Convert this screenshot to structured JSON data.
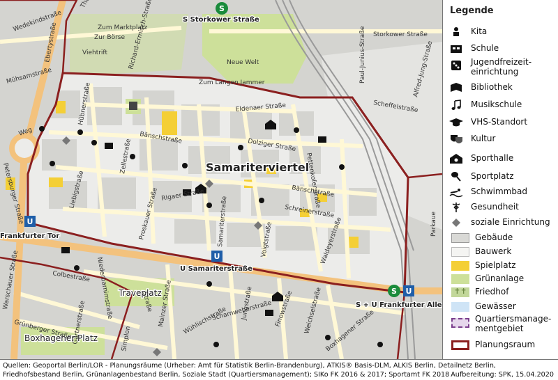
{
  "map": {
    "area_label": "Samariterviertel",
    "stations": {
      "storkower": "S Storkower Straße",
      "frankfurter_tor": "Frankfurter Tor",
      "samariterstrasse": "U Samariterstraße",
      "frankfurter_allee": "S + U Frankfurter Allee"
    },
    "places": {
      "traveplatz": "Traveplatz",
      "boxhagener_platz": "Boxhagener Platz"
    },
    "streets": {
      "storkower": "Storkower Straße",
      "zum_langen_jammer": "Zum Langen Jammer",
      "neue_welt": "Neue Welt",
      "viehtrift": "Viehtrift",
      "zur_boerse": "Zur Börse",
      "zum_marktplatz": "Zum Marktplatz",
      "thaerstrasse": "Thaerstraße",
      "richard_ermisch": "Richard-Ermisch-Straße",
      "paul_junius": "Paul-Junius-Straße",
      "alfred_jung": "Alfred-Jung-Straße",
      "scheffelstrasse": "Scheffelstraße",
      "mühsamstrasse": "Mühsamstraße",
      "ebertystrasse": "Ebertystraße",
      "wedekindstrasse": "Wedekindstraße",
      "huebnerstrasse": "Hübnerstraße",
      "eldenaer": "Eldenaer Straße",
      "dolziger": "Dolziger Straße",
      "baenschstrasse": "Bänschstraße",
      "baenschstrasse2": "Bänschstraße",
      "schreinerstrasse": "Schreinerstraße",
      "liebigstrasse": "Liebigstraße",
      "rigaer": "Rigaer Straße",
      "proskauer": "Proskauer Straße",
      "samariterstrasse": "Samariterstraße",
      "voigtstrasse": "Voigtstraße",
      "waldeyerstrasse": "Waldeyerstraße",
      "pettenkofer": "Pettenkoferstraße",
      "zellestrasse": "Zellestraße",
      "petersburger": "Petersburger Straße",
      "niederbarnim": "Niederbarnimstraße",
      "colbestrasse": "Colbestraße",
      "mainzer": "Mainzer Straße",
      "jungstrasse": "Jungstraße",
      "finowstrasse": "Finowstraße",
      "weichselstrasse": "Weichselstraße",
      "wuehlischstrasse": "Wühlischstraße",
      "scharnweber": "Scharnweberstraße",
      "grunberger": "Grünberger Straße",
      "boxhagener": "Boxhagener Straße",
      "warschauer": "Warschauer Straße",
      "gaertnerstrasse": "Gärtnerstraße",
      "simplon": "Simplon",
      "parkaue": "Parkaue",
      "eiskellerweg": "Weg",
      "marchstrasse": "Straße"
    },
    "colors": {
      "building": "#d9d9d6",
      "structure": "#f4f4f2",
      "playground": "#f4cf36",
      "green": "#cde09a",
      "cemetery": "#c2d79a",
      "water": "#cfe4f6",
      "qm_border": "#7a3e8c",
      "qm_fill": "#e6d7ec",
      "plan_border": "#8b1f1f",
      "road_major": "#f3c27d",
      "road": "#fff8d6",
      "rail": "#9a9a9a",
      "ubahn": "#1f5ea8",
      "sbahn": "#1a8b3b"
    }
  },
  "legend": {
    "title": "Legende",
    "items": [
      {
        "label": "Kita",
        "icon": "kita-icon"
      },
      {
        "label": "Schule",
        "icon": "school-icon"
      },
      {
        "label": "Jugendfreizeit-\neinrichtung",
        "icon": "youth-center-icon"
      },
      {
        "label": "Bibliothek",
        "icon": "library-icon"
      },
      {
        "label": "Musikschule",
        "icon": "music-note-icon"
      },
      {
        "label": "VHS-Standort",
        "icon": "graduation-cap-icon"
      },
      {
        "label": "Kultur",
        "icon": "theater-masks-icon"
      },
      {
        "label": "Sporthalle",
        "icon": "sports-hall-icon"
      },
      {
        "label": "Sportplatz",
        "icon": "tennis-racket-icon"
      },
      {
        "label": "Schwimmbad",
        "icon": "swimmer-icon"
      },
      {
        "label": "Gesundheit",
        "icon": "caduceus-icon"
      },
      {
        "label": "soziale Einrichtung",
        "icon": "diamond-icon"
      },
      {
        "label": "Gebäude",
        "swatch": "building"
      },
      {
        "label": "Bauwerk",
        "swatch": "structure"
      },
      {
        "label": "Spielplatz",
        "swatch": "playground"
      },
      {
        "label": "Grünanlage",
        "swatch": "green"
      },
      {
        "label": "Friedhof",
        "swatch": "cemetery"
      },
      {
        "label": "Gewässer",
        "swatch": "water"
      },
      {
        "label": "Quartiersmanage-\nmentgebiet",
        "swatch": "qm"
      },
      {
        "label": "Planungsraum",
        "swatch": "plan"
      }
    ]
  },
  "footer": {
    "sources": "Quellen: Geoportal Berlin/LOR - Planungsräume (Urheber: Amt für Statistik Berlin-Brandenburg), ATKIS® Basis-DLM, ALKIS Berlin, Detailnetz Berlin, Friedhofsbestand Berlin, Grünanlagenbestand Berlin, Soziale Stadt (Quartiersmanagement); SIKo FK 2016 & 2017; Sportamt FK 2018",
    "prepared": "Aufbereitung: SPK, 15.04.2020"
  }
}
